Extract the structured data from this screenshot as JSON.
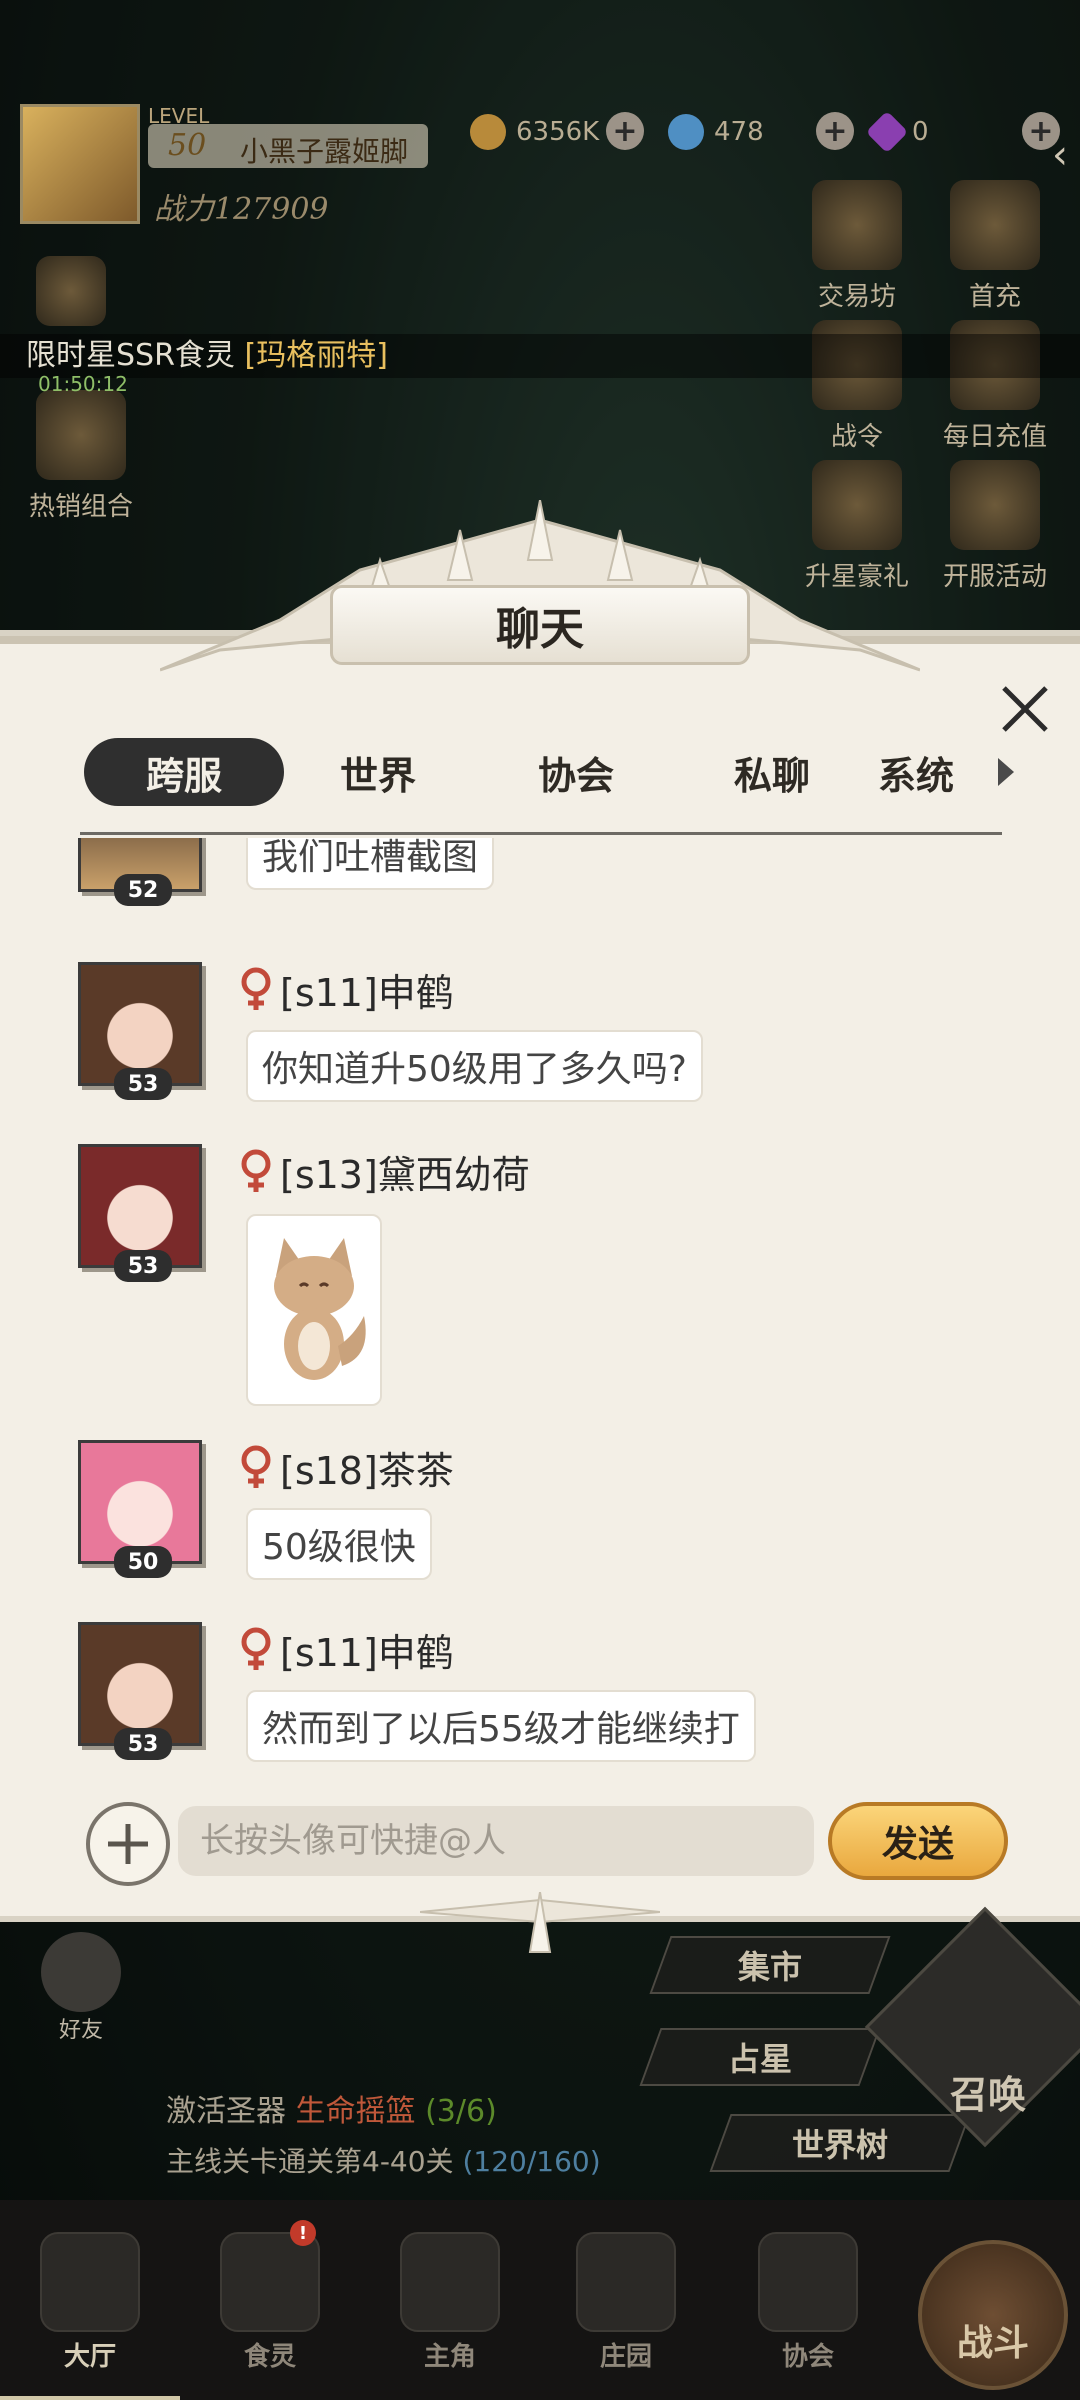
{
  "hud": {
    "level_label": "LEVEL",
    "level": "50",
    "player_name": "小黑子露姬脚",
    "power": "战力127909",
    "gold": "6356K",
    "gems": "478",
    "diamonds": "0",
    "buttons": [
      {
        "label": "交易坊",
        "icon": "scales-icon"
      },
      {
        "label": "首充",
        "icon": "diamond-icon"
      },
      {
        "label": "战令",
        "icon": "banner-icon"
      },
      {
        "label": "每日充值",
        "icon": "cake-icon"
      },
      {
        "label": "升星豪礼",
        "icon": "gift-icon"
      },
      {
        "label": "开服活动",
        "icon": "rose-icon"
      },
      {
        "label": "热销组合",
        "icon": "bundle-icon"
      }
    ],
    "limited_label": "限时",
    "timer": "01:50:12",
    "ticker_prefix": "星SSR食灵",
    "ticker_name": "[玛格丽特]"
  },
  "chat": {
    "title": "聊天",
    "tabs": [
      "跨服",
      "世界",
      "协会",
      "私聊",
      "系统"
    ],
    "active_tab": "跨服",
    "messages": [
      {
        "sender": "",
        "level": "52",
        "text": "我们吐槽截图"
      },
      {
        "sender": "[s11]申鹤",
        "level": "53",
        "text": "你知道升50级用了多久吗?"
      },
      {
        "sender": "[s13]黛西幼荷",
        "level": "53",
        "text": "",
        "sticker": "fox-sticker"
      },
      {
        "sender": "[s18]茶茶",
        "level": "50",
        "text": "50级很快"
      },
      {
        "sender": "[s11]申鹤",
        "level": "53",
        "text": "然而到了以后55级才能继续打"
      }
    ],
    "input_placeholder": "长按头像可快捷@人",
    "send_label": "发送"
  },
  "lower": {
    "friend_label": "好友",
    "menu": [
      "集市",
      "占星",
      "世界树"
    ],
    "summon_label": "召唤",
    "quest1_prefix": "激活圣器",
    "quest1_item": "生命摇篮",
    "quest1_progress": "(3/6)",
    "quest2_text": "主线关卡通关第4-40关",
    "quest2_progress": "(120/160)"
  },
  "nav": {
    "items": [
      "大厅",
      "食灵",
      "主角",
      "庄园",
      "协会"
    ],
    "battle": "战斗"
  }
}
